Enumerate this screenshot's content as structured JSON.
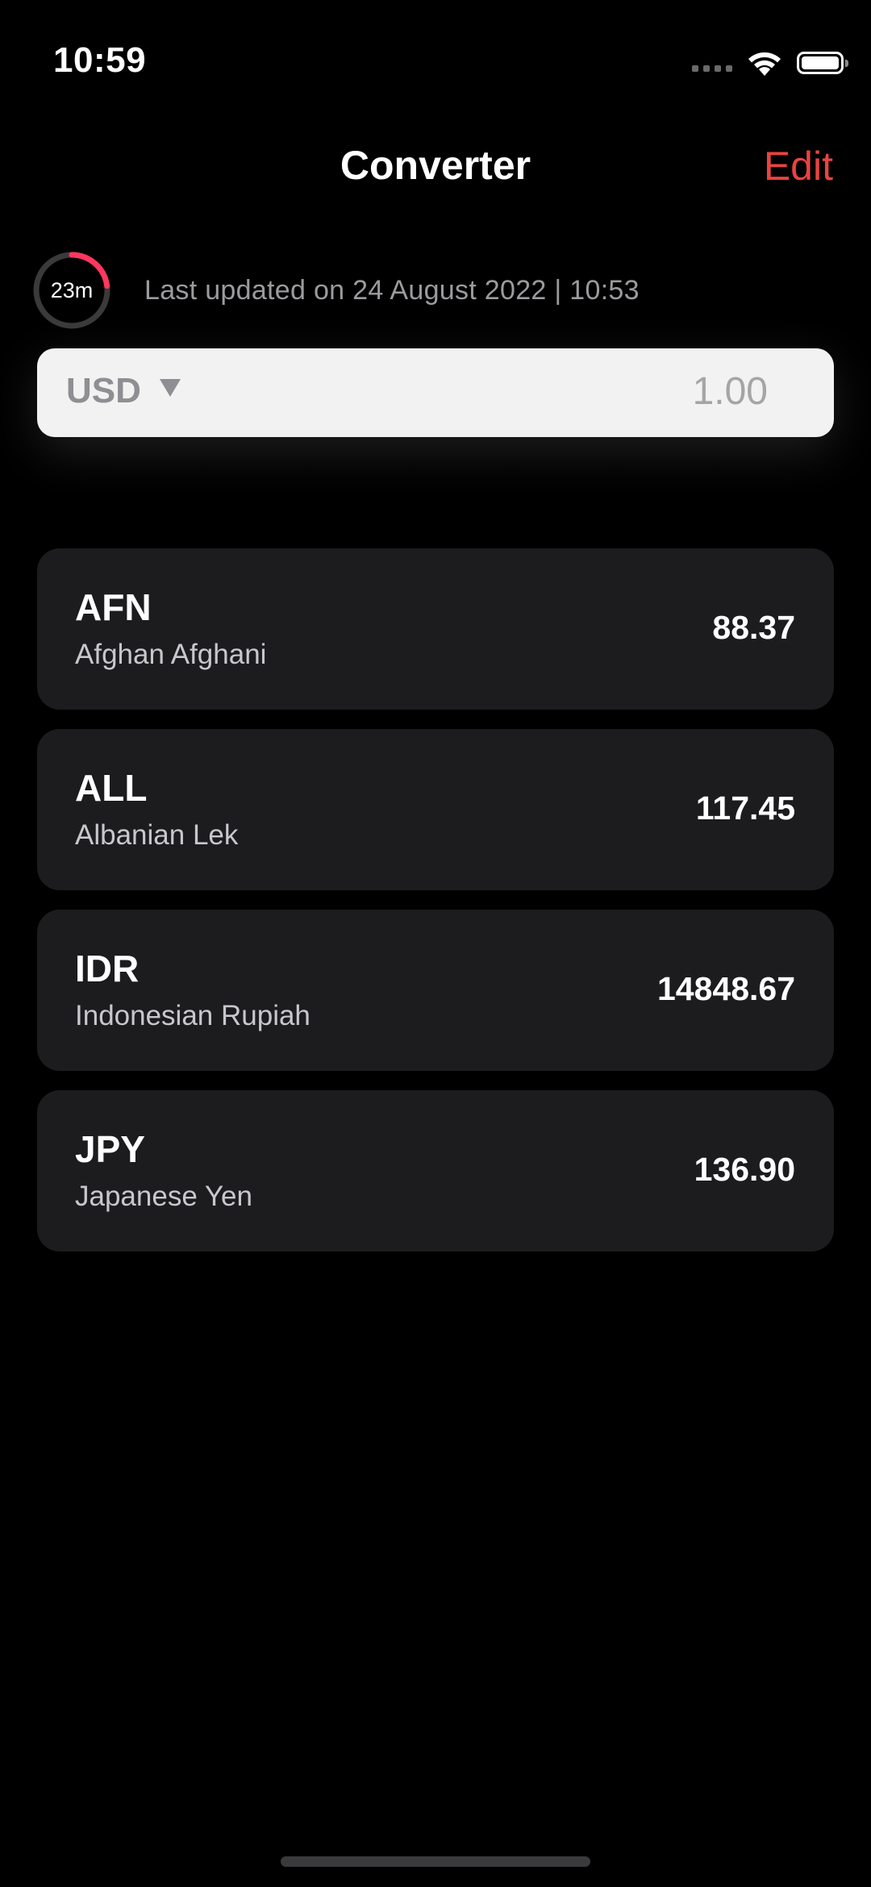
{
  "status_bar": {
    "time": "10:59",
    "icons": [
      "cellular-signal-icon",
      "wifi-icon",
      "battery-icon"
    ]
  },
  "nav": {
    "title": "Converter",
    "edit_label": "Edit"
  },
  "update_info": {
    "timer_label": "23m",
    "timer_progress": 0.23,
    "last_updated": "Last updated on 24 August 2022 | 10:53"
  },
  "base_currency": {
    "code": "USD",
    "amount": "1.00"
  },
  "currencies": [
    {
      "code": "AFN",
      "name": "Afghan Afghani",
      "value": "88.37"
    },
    {
      "code": "ALL",
      "name": "Albanian Lek",
      "value": "117.45"
    },
    {
      "code": "IDR",
      "name": "Indonesian Rupiah",
      "value": "14848.67"
    },
    {
      "code": "JPY",
      "name": "Japanese Yen",
      "value": "136.90"
    }
  ],
  "colors": {
    "accent": "#e8443f",
    "timer_ring": "#ff375f",
    "card_background": "#1c1c1e",
    "background": "#000000"
  }
}
